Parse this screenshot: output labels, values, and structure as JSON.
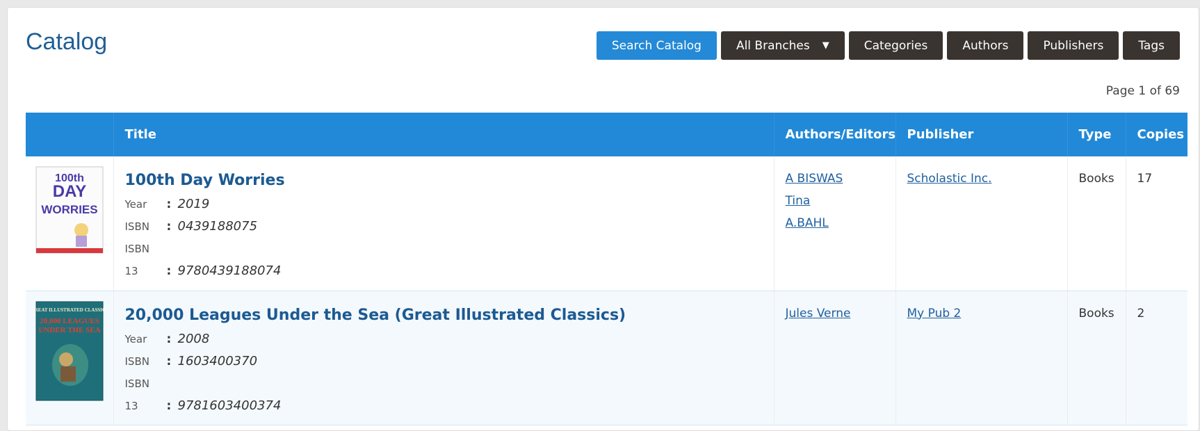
{
  "page": {
    "title": "Catalog",
    "page_info": "Page 1 of 69"
  },
  "toolbar": {
    "search": "Search Catalog",
    "branches": "All Branches",
    "categories": "Categories",
    "authors": "Authors",
    "publishers": "Publishers",
    "tags": "Tags"
  },
  "columns": [
    "",
    "Title",
    "Authors/Editors",
    "Publisher",
    "Type",
    "Copies"
  ],
  "labels": {
    "year": "Year",
    "isbn": "ISBN",
    "isbn13_a": "ISBN",
    "isbn13_b": "13"
  },
  "rows": [
    {
      "title": "100th Day Worries",
      "year": "2019",
      "isbn": "0439188075",
      "isbn13": "9780439188074",
      "authors": [
        "A BISWAS",
        "Tina",
        "A.BAHL"
      ],
      "publisher": "Scholastic Inc.",
      "type": "Books",
      "copies": "17",
      "cover": {
        "line1": "100th",
        "line2": "DAY",
        "line3": "WORRIES"
      }
    },
    {
      "title": "20,000 Leagues Under the Sea (Great Illustrated Classics)",
      "year": "2008",
      "isbn": "1603400370",
      "isbn13": "9781603400374",
      "authors": [
        "Jules Verne"
      ],
      "publisher": "My Pub 2",
      "type": "Books",
      "copies": "2",
      "cover": {
        "line1": "GREAT ILLUSTRATED CLASSICS",
        "line2": "20,000 LEAGUES",
        "line3": "UNDER THE SEA"
      }
    }
  ],
  "colors": {
    "accent": "#2189d7",
    "title": "#1c5a92",
    "dark_button": "#3a3430"
  }
}
